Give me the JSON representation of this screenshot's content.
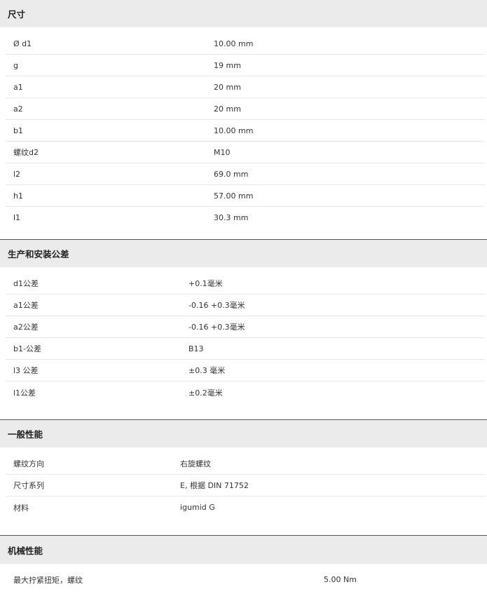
{
  "sections": [
    {
      "title": "尺寸",
      "rows": [
        {
          "label": "Ø d1",
          "value": "10.00 mm"
        },
        {
          "label": "g",
          "value": "19 mm"
        },
        {
          "label": "a1",
          "value": "20 mm"
        },
        {
          "label": "a2",
          "value": "20 mm"
        },
        {
          "label": "b1",
          "value": "10.00 mm"
        },
        {
          "label": "螺纹d2",
          "value": "M10"
        },
        {
          "label": "l2",
          "value": "69.0 mm"
        },
        {
          "label": "h1",
          "value": "57.00 mm"
        },
        {
          "label": "l1",
          "value": "30.3 mm"
        }
      ]
    },
    {
      "title": "生产和安装公差",
      "rows": [
        {
          "label": "d1公差",
          "value": "+0.1毫米"
        },
        {
          "label": "a1公差",
          "value": "-0.16 +0.3毫米"
        },
        {
          "label": "a2公差",
          "value": "-0.16 +0.3毫米"
        },
        {
          "label": "b1-公差",
          "value": "B13"
        },
        {
          "label": "l3 公差",
          "value": "±0.3 毫米"
        },
        {
          "label": "l1公差",
          "value": "±0.2毫米"
        }
      ]
    },
    {
      "title": "一般性能",
      "rows": [
        {
          "label": "螺纹方向",
          "value": "右旋螺纹"
        },
        {
          "label": "尺寸系列",
          "value": "E, 根据 DIN 71752"
        },
        {
          "label": "材料",
          "value": "igumid G"
        }
      ]
    },
    {
      "title": "机械性能",
      "rows": [
        {
          "label": "最大拧紧扭矩，螺纹",
          "value": "5.00 Nm"
        }
      ]
    }
  ]
}
